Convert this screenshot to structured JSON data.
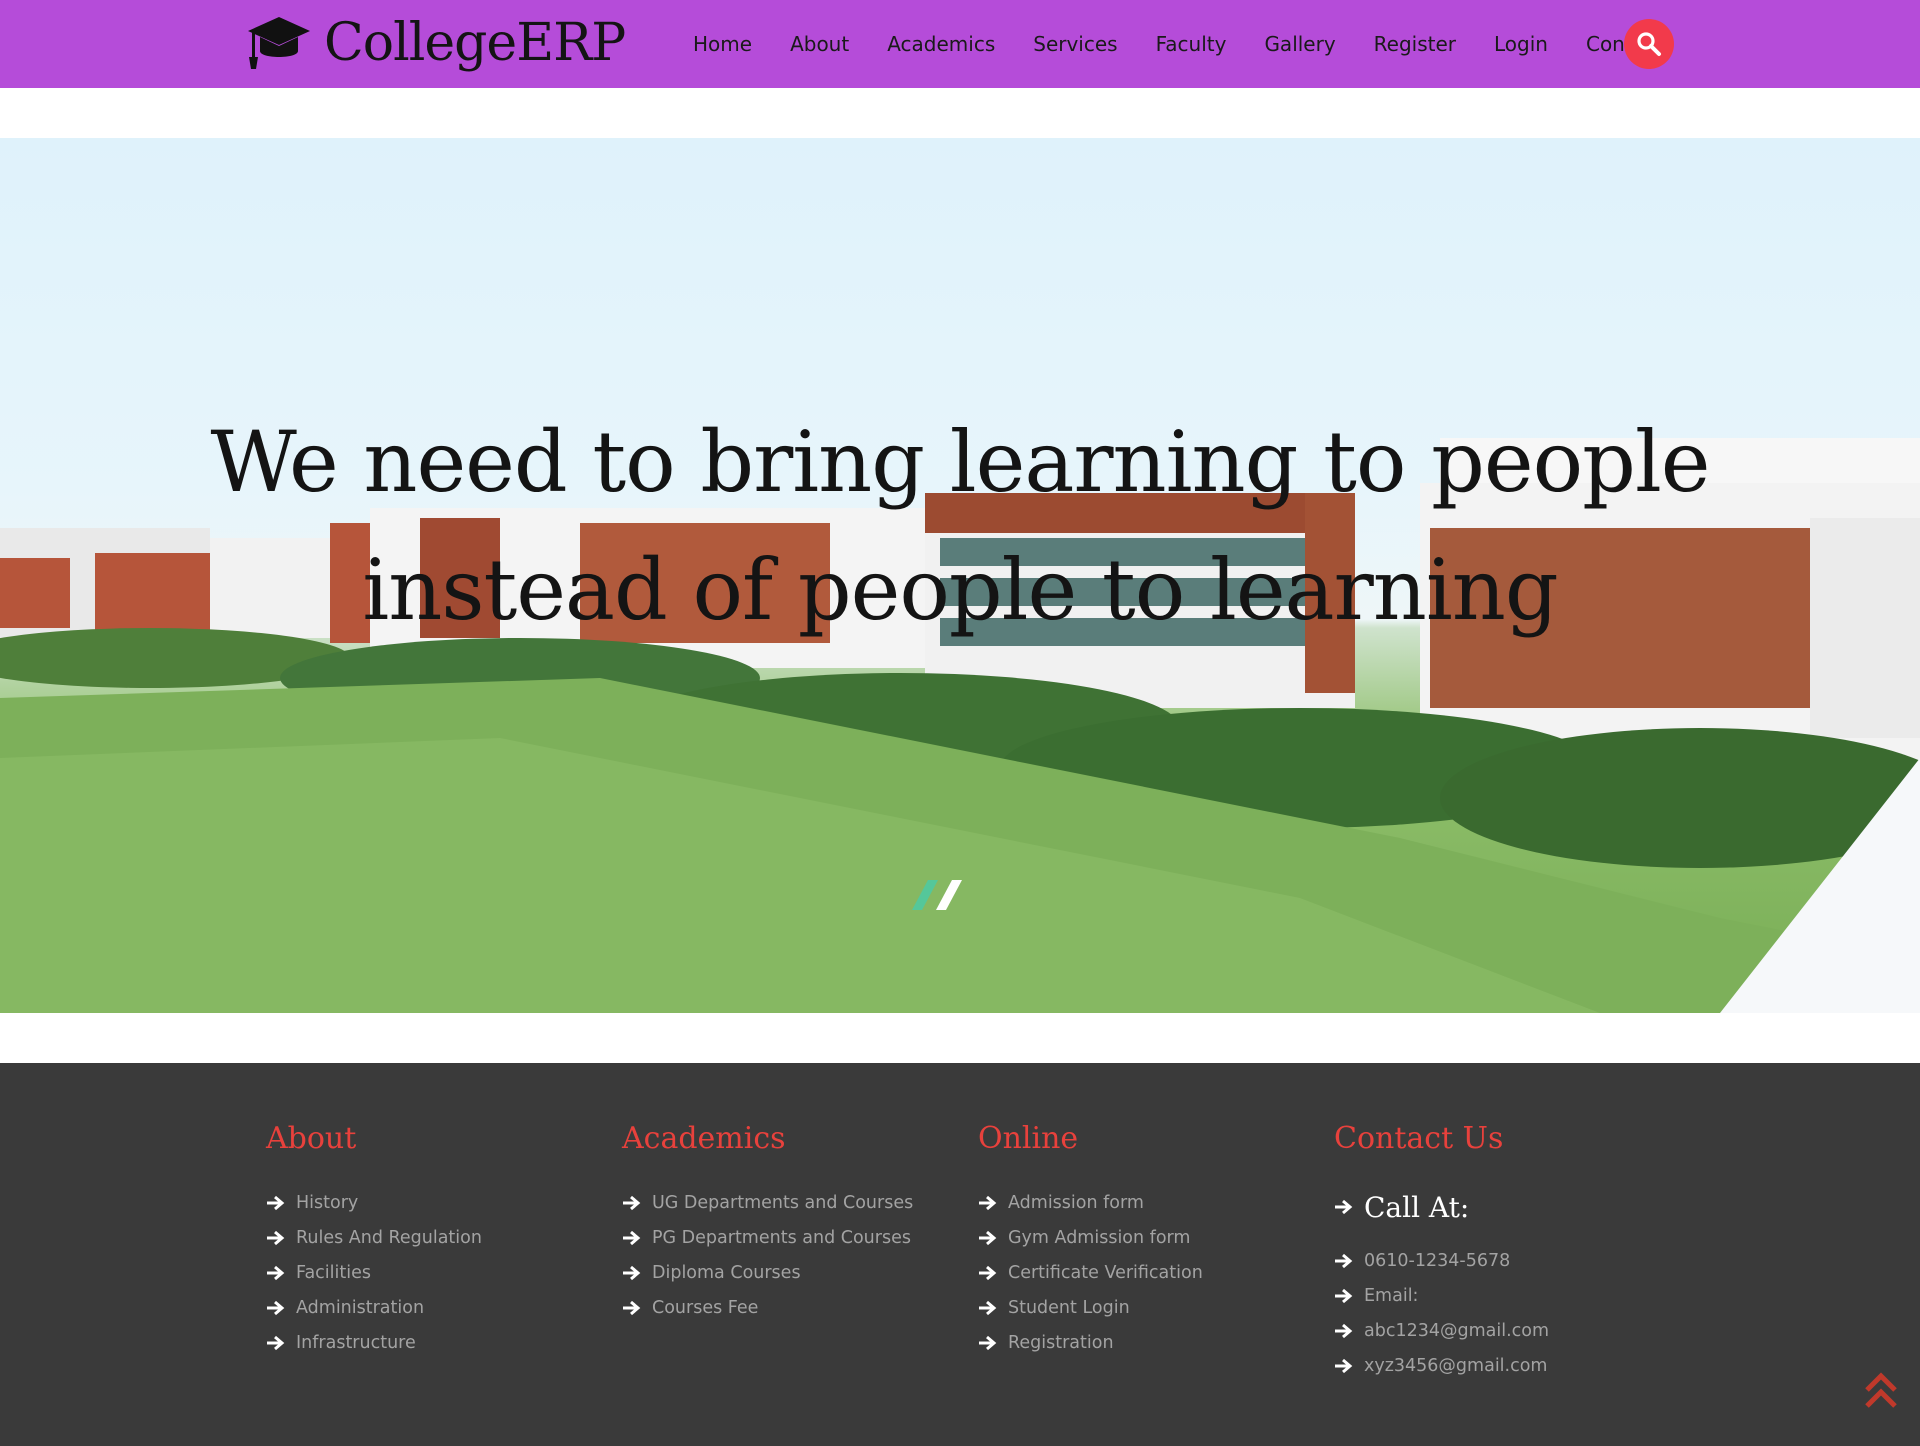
{
  "header": {
    "brand": "CollegeERP",
    "nav": [
      {
        "label": "Home"
      },
      {
        "label": "About"
      },
      {
        "label": "Academics"
      },
      {
        "label": "Services"
      },
      {
        "label": "Faculty"
      },
      {
        "label": "Gallery"
      },
      {
        "label": "Register"
      },
      {
        "label": "Login"
      },
      {
        "label": "Contact"
      }
    ],
    "search_icon": "search-icon",
    "colors": {
      "bar": "#b54cd9",
      "search": "#f23a4b"
    }
  },
  "hero": {
    "quote_line1": "We need to bring learning to people",
    "quote_line2": "instead of people to learning",
    "slides_count": 2,
    "active_slide": 1
  },
  "footer": {
    "about": {
      "title": "About",
      "links": [
        "History",
        "Rules And Regulation",
        "Facilities",
        "Administration",
        "Infrastructure"
      ]
    },
    "academics": {
      "title": "Academics",
      "links": [
        "UG Departments and Courses",
        "PG Departments and Courses",
        "Diploma Courses",
        "Courses Fee"
      ]
    },
    "online": {
      "title": "Online",
      "links": [
        "Admission form",
        "Gym Admission form",
        "Certificate Verification",
        "Student Login",
        "Registration"
      ]
    },
    "contact": {
      "title": "Contact Us",
      "call_at": "Call At:",
      "phone": "0610-1234-5678",
      "email_label": "Email:",
      "email1": "abc1234@gmail.com",
      "email2": "xyz3456@gmail.com"
    },
    "colors": {
      "background": "#3a3a3a",
      "heading": "#e8413c",
      "link": "#a3a3a3"
    }
  },
  "scroll_top_icon": "double-chevron-up-icon"
}
